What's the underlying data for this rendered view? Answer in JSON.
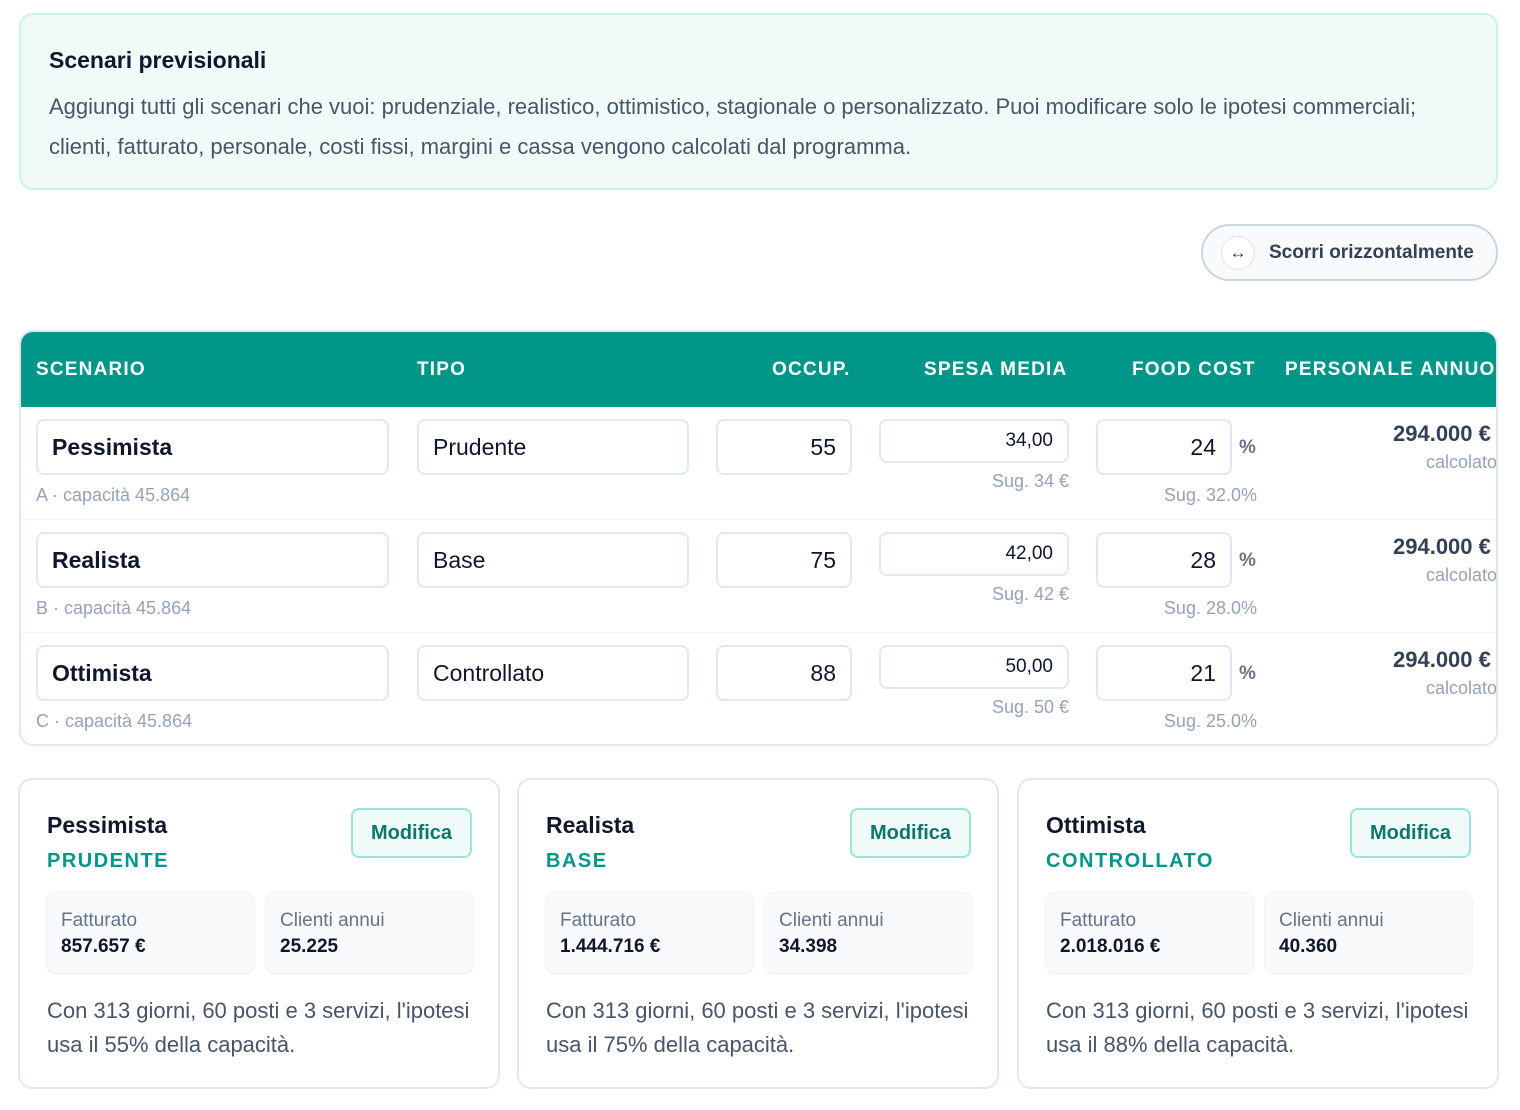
{
  "info": {
    "title": "Scenari previsionali",
    "text": "Aggiungi tutti gli scenari che vuoi: prudenziale, realistico, ottimistico, stagionale o personalizzato. Puoi modificare solo le ipotesi commerciali; clienti, fatturato, personale, costi fissi, margini e cassa vengono calcolati dal programma."
  },
  "scroll": {
    "icon": "↔",
    "label": "Scorri orizzontalmente"
  },
  "table": {
    "headers": {
      "scenario": "SCENARIO",
      "tipo": "TIPO",
      "occup": "OCCUP.",
      "spesa": "SPESA MEDIA",
      "food": "FOOD COST",
      "personale": "PERSONALE ANNUO"
    },
    "rows": [
      {
        "name": "Pessimista",
        "sub": "A · capacità 45.864",
        "tipo": "Prudente",
        "occup": "55",
        "spesa": "34,00",
        "spesa_sug": "Sug. 34 €",
        "food": "24",
        "pct": "%",
        "food_sug": "Sug. 32.0%",
        "personale": "294.000 €",
        "personale_sub": "calcolato"
      },
      {
        "name": "Realista",
        "sub": "B · capacità 45.864",
        "tipo": "Base",
        "occup": "75",
        "spesa": "42,00",
        "spesa_sug": "Sug. 42 €",
        "food": "28",
        "pct": "%",
        "food_sug": "Sug. 28.0%",
        "personale": "294.000 €",
        "personale_sub": "calcolato"
      },
      {
        "name": "Ottimista",
        "sub": "C · capacità 45.864",
        "tipo": "Controllato",
        "occup": "88",
        "spesa": "50,00",
        "spesa_sug": "Sug. 50 €",
        "food": "21",
        "pct": "%",
        "food_sug": "Sug. 25.0%",
        "personale": "294.000 €",
        "personale_sub": "calcolato"
      }
    ]
  },
  "cards": [
    {
      "name": "Pessimista",
      "type": "PRUDENTE",
      "edit": "Modifica",
      "fatt_label": "Fatturato",
      "fatt": "857.657 €",
      "clienti_label": "Clienti annui",
      "clienti": "25.225",
      "desc": "Con 313 giorni, 60 posti e 3 servizi, l'ipotesi usa il 55% della capacità."
    },
    {
      "name": "Realista",
      "type": "BASE",
      "edit": "Modifica",
      "fatt_label": "Fatturato",
      "fatt": "1.444.716 €",
      "clienti_label": "Clienti annui",
      "clienti": "34.398",
      "desc": "Con 313 giorni, 60 posti e 3 servizi, l'ipotesi usa il 75% della capacità."
    },
    {
      "name": "Ottimista",
      "type": "CONTROLLATO",
      "edit": "Modifica",
      "fatt_label": "Fatturato",
      "fatt": "2.018.016 €",
      "clienti_label": "Clienti annui",
      "clienti": "40.360",
      "desc": "Con 313 giorni, 60 posti e 3 servizi, l'ipotesi usa il 88% della capacità."
    }
  ],
  "colors": {
    "accent": "#009688",
    "accent_light": "#f0fbf9"
  }
}
